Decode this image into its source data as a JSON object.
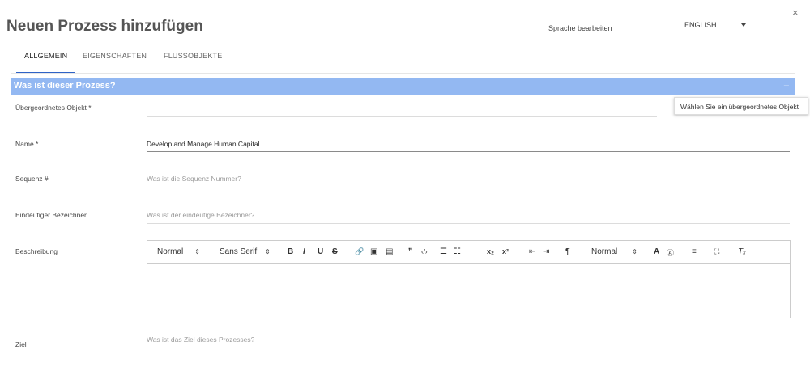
{
  "dialog": {
    "title": "Neuen Prozess hinzufügen",
    "close_icon": "×",
    "language_label": "Sprache bearbeiten",
    "language_value": "ENGLISH"
  },
  "tabs": [
    {
      "label": "ALLGEMEIN",
      "active": true
    },
    {
      "label": "EIGENSCHAFTEN",
      "active": false
    },
    {
      "label": "FLUSSOBJEKTE",
      "active": false
    }
  ],
  "section": {
    "title": "Was ist dieser Prozess?",
    "collapse_icon": "–",
    "color": "#93b8f2"
  },
  "tooltip": "Wählen Sie ein übergeordnetes Objekt",
  "fields": {
    "parent": {
      "label": "Übergeordnetes Objekt *",
      "value": ""
    },
    "name": {
      "label": "Name *",
      "value": "Develop and Manage Human Capital"
    },
    "sequence": {
      "label": "Sequenz #",
      "placeholder": "Was ist die Sequenz Nummer?"
    },
    "identifier": {
      "label": "Eindeutiger Bezeichner",
      "placeholder": "Was ist der eindeutige Bezeichner?"
    },
    "description": {
      "label": "Beschreibung"
    },
    "goal": {
      "label": "Ziel",
      "placeholder": "Was ist das Ziel dieses Prozesses?"
    }
  },
  "toolbar": {
    "header": "Normal",
    "font": "Sans Serif",
    "size": "Normal",
    "arrow": "⇕",
    "bold": "B",
    "italic": "I",
    "underline": "U",
    "strike": "S",
    "link": "🔗",
    "image": "▣",
    "video": "▤",
    "blockquote": "❞",
    "code": "‹/›",
    "ordered_list": "☰",
    "bullet_list": "☷",
    "subscript": "x₂",
    "superscript": "x²",
    "outdent": "⇤",
    "indent": "⇥",
    "direction": "¶",
    "font_color": "A",
    "background": "Ⓐ",
    "align": "≡",
    "fullscreen": "⛶",
    "clean": "Tₓ"
  },
  "accent": "#2f63c6"
}
